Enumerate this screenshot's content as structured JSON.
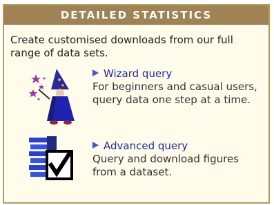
{
  "header": {
    "title": "DETAILED STATISTICS"
  },
  "intro": "Create customised downloads from our full range of data sets.",
  "queries": [
    {
      "label": "Wizard query",
      "description": "For beginners and casual users, query data one step at a time.",
      "icon": "wizard-icon"
    },
    {
      "label": "Advanced query",
      "description": "Query and download figures from a dataset.",
      "icon": "checklist-icon"
    }
  ],
  "colors": {
    "header_bg": "#a08353",
    "panel_bg": "#fffcec",
    "border": "#b89a5c",
    "link": "#1f2aa8"
  }
}
